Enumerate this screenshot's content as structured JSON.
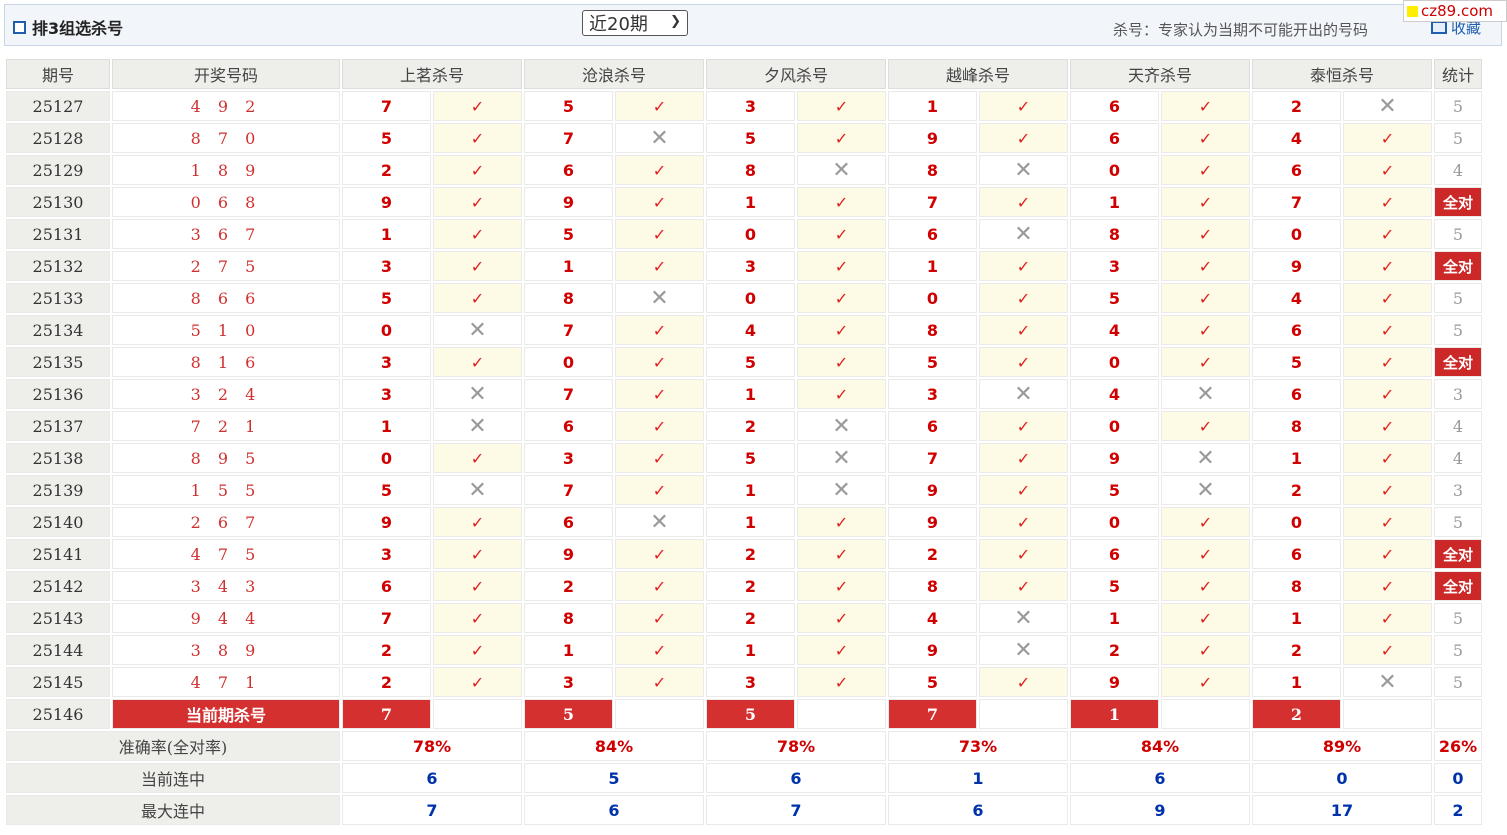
{
  "header": {
    "title": "排3组选杀号",
    "period_select": "近20期",
    "note": "杀号：专家认为当期不可能开出的号码",
    "fav_label": "收藏",
    "logo_text": "cz89.com"
  },
  "columns": {
    "period": "期号",
    "draw": "开奖号码",
    "experts": [
      "上茗杀号",
      "沧浪杀号",
      "夕风杀号",
      "越峰杀号",
      "天齐杀号",
      "泰恒杀号"
    ],
    "stat": "统计"
  },
  "rows": [
    {
      "period": "25127",
      "draw": "4 9 2",
      "kills": [
        "7",
        "5",
        "3",
        "1",
        "6",
        "2"
      ],
      "hits": [
        true,
        true,
        true,
        true,
        true,
        false
      ],
      "stat": "5"
    },
    {
      "period": "25128",
      "draw": "8 7 0",
      "kills": [
        "5",
        "7",
        "5",
        "9",
        "6",
        "4"
      ],
      "hits": [
        true,
        false,
        true,
        true,
        true,
        true
      ],
      "stat": "5"
    },
    {
      "period": "25129",
      "draw": "1 8 9",
      "kills": [
        "2",
        "6",
        "8",
        "8",
        "0",
        "6"
      ],
      "hits": [
        true,
        true,
        false,
        false,
        true,
        true
      ],
      "stat": "4"
    },
    {
      "period": "25130",
      "draw": "0 6 8",
      "kills": [
        "9",
        "9",
        "1",
        "7",
        "1",
        "7"
      ],
      "hits": [
        true,
        true,
        true,
        true,
        true,
        true
      ],
      "stat": "全对"
    },
    {
      "period": "25131",
      "draw": "3 6 7",
      "kills": [
        "1",
        "5",
        "0",
        "6",
        "8",
        "0"
      ],
      "hits": [
        true,
        true,
        true,
        false,
        true,
        true
      ],
      "stat": "5"
    },
    {
      "period": "25132",
      "draw": "2 7 5",
      "kills": [
        "3",
        "1",
        "3",
        "1",
        "3",
        "9"
      ],
      "hits": [
        true,
        true,
        true,
        true,
        true,
        true
      ],
      "stat": "全对"
    },
    {
      "period": "25133",
      "draw": "8 6 6",
      "kills": [
        "5",
        "8",
        "0",
        "0",
        "5",
        "4"
      ],
      "hits": [
        true,
        false,
        true,
        true,
        true,
        true
      ],
      "stat": "5"
    },
    {
      "period": "25134",
      "draw": "5 1 0",
      "kills": [
        "0",
        "7",
        "4",
        "8",
        "4",
        "6"
      ],
      "hits": [
        false,
        true,
        true,
        true,
        true,
        true
      ],
      "stat": "5"
    },
    {
      "period": "25135",
      "draw": "8 1 6",
      "kills": [
        "3",
        "0",
        "5",
        "5",
        "0",
        "5"
      ],
      "hits": [
        true,
        true,
        true,
        true,
        true,
        true
      ],
      "stat": "全对"
    },
    {
      "period": "25136",
      "draw": "3 2 4",
      "kills": [
        "3",
        "7",
        "1",
        "3",
        "4",
        "6"
      ],
      "hits": [
        false,
        true,
        true,
        false,
        false,
        true
      ],
      "stat": "3"
    },
    {
      "period": "25137",
      "draw": "7 2 1",
      "kills": [
        "1",
        "6",
        "2",
        "6",
        "0",
        "8"
      ],
      "hits": [
        false,
        true,
        false,
        true,
        true,
        true
      ],
      "stat": "4"
    },
    {
      "period": "25138",
      "draw": "8 9 5",
      "kills": [
        "0",
        "3",
        "5",
        "7",
        "9",
        "1"
      ],
      "hits": [
        true,
        true,
        false,
        true,
        false,
        true
      ],
      "stat": "4"
    },
    {
      "period": "25139",
      "draw": "1 5 5",
      "kills": [
        "5",
        "7",
        "1",
        "9",
        "5",
        "2"
      ],
      "hits": [
        false,
        true,
        false,
        true,
        false,
        true
      ],
      "stat": "3"
    },
    {
      "period": "25140",
      "draw": "2 6 7",
      "kills": [
        "9",
        "6",
        "1",
        "9",
        "0",
        "0"
      ],
      "hits": [
        true,
        false,
        true,
        true,
        true,
        true
      ],
      "stat": "5"
    },
    {
      "period": "25141",
      "draw": "4 7 5",
      "kills": [
        "3",
        "9",
        "2",
        "2",
        "6",
        "6"
      ],
      "hits": [
        true,
        true,
        true,
        true,
        true,
        true
      ],
      "stat": "全对"
    },
    {
      "period": "25142",
      "draw": "3 4 3",
      "kills": [
        "6",
        "2",
        "2",
        "8",
        "5",
        "8"
      ],
      "hits": [
        true,
        true,
        true,
        true,
        true,
        true
      ],
      "stat": "全对"
    },
    {
      "period": "25143",
      "draw": "9 4 4",
      "kills": [
        "7",
        "8",
        "2",
        "4",
        "1",
        "1"
      ],
      "hits": [
        true,
        true,
        true,
        false,
        true,
        true
      ],
      "stat": "5"
    },
    {
      "period": "25144",
      "draw": "3 8 9",
      "kills": [
        "2",
        "1",
        "1",
        "9",
        "2",
        "2"
      ],
      "hits": [
        true,
        true,
        true,
        false,
        true,
        true
      ],
      "stat": "5"
    },
    {
      "period": "25145",
      "draw": "4 7 1",
      "kills": [
        "2",
        "3",
        "3",
        "5",
        "9",
        "1"
      ],
      "hits": [
        true,
        true,
        true,
        true,
        true,
        false
      ],
      "stat": "5"
    }
  ],
  "current": {
    "period": "25146",
    "label": "当前期杀号",
    "kills": [
      "7",
      "5",
      "5",
      "7",
      "1",
      "2"
    ]
  },
  "summary": {
    "accuracy_label": "准确率(全对率)",
    "accuracy": [
      "78%",
      "84%",
      "78%",
      "73%",
      "84%",
      "89%",
      "26%"
    ],
    "current_streak_label": "当前连中",
    "current_streak": [
      "6",
      "5",
      "6",
      "1",
      "6",
      "0",
      "0"
    ],
    "max_streak_label": "最大连中",
    "max_streak": [
      "7",
      "6",
      "7",
      "6",
      "9",
      "17",
      "2"
    ]
  },
  "marks": {
    "hit": "✓",
    "miss": "✕"
  },
  "colors": {
    "accent_red": "#cc2828",
    "hit_bg": "#fdfbe6",
    "count_blue": "#0033aa"
  }
}
